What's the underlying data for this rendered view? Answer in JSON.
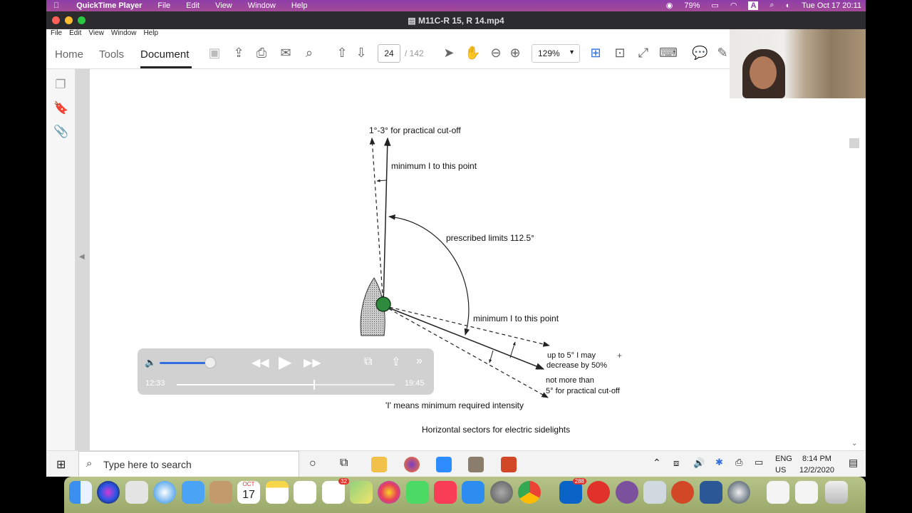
{
  "menubar": {
    "app_name": "QuickTime Player",
    "items": [
      "File",
      "Edit",
      "View",
      "Window",
      "Help"
    ],
    "battery": "79%",
    "datetime": "Tue Oct 17  20:11"
  },
  "window": {
    "title": "M11C-R 15, R 14.mp4"
  },
  "acrobat_menu": [
    "File",
    "Edit",
    "View",
    "Window",
    "Help"
  ],
  "toolbar": {
    "tabs": [
      "Home",
      "Tools",
      "Document"
    ],
    "page_current": "24",
    "page_total": "/ 142",
    "zoom": "129%"
  },
  "diagram": {
    "label_top": "1°-3° for practical cut-off",
    "label_min1": "minimum I to this point",
    "label_prescribed": "prescribed limits 112.5°",
    "label_min2": "minimum I to this point",
    "label_upto_1": "up to 5° I may",
    "label_upto_2": "decrease by 50%",
    "label_notmore_1": "not more than",
    "label_notmore_2": "5° for practical cut-off",
    "label_intensity": "'I' means minimum required intensity",
    "caption": "Horizontal sectors for electric sidelights"
  },
  "player": {
    "time_current": "12:33",
    "time_remaining": "19:45",
    "progress_fraction": 0.63,
    "volume_fraction": 1.0
  },
  "taskbar": {
    "search_placeholder": "Type here to search",
    "lang_1": "ENG",
    "lang_2": "US",
    "time": "8:14 PM",
    "date": "12/2/2020"
  },
  "dock": {
    "calendar_month": "OCT",
    "calendar_day": "17",
    "reminders_badge": "32",
    "outlook_badge": "288"
  },
  "colors": {
    "menubar": "#9a449f",
    "player_blue": "#2f6fe0",
    "running_light_green": "#2e8b3e"
  }
}
